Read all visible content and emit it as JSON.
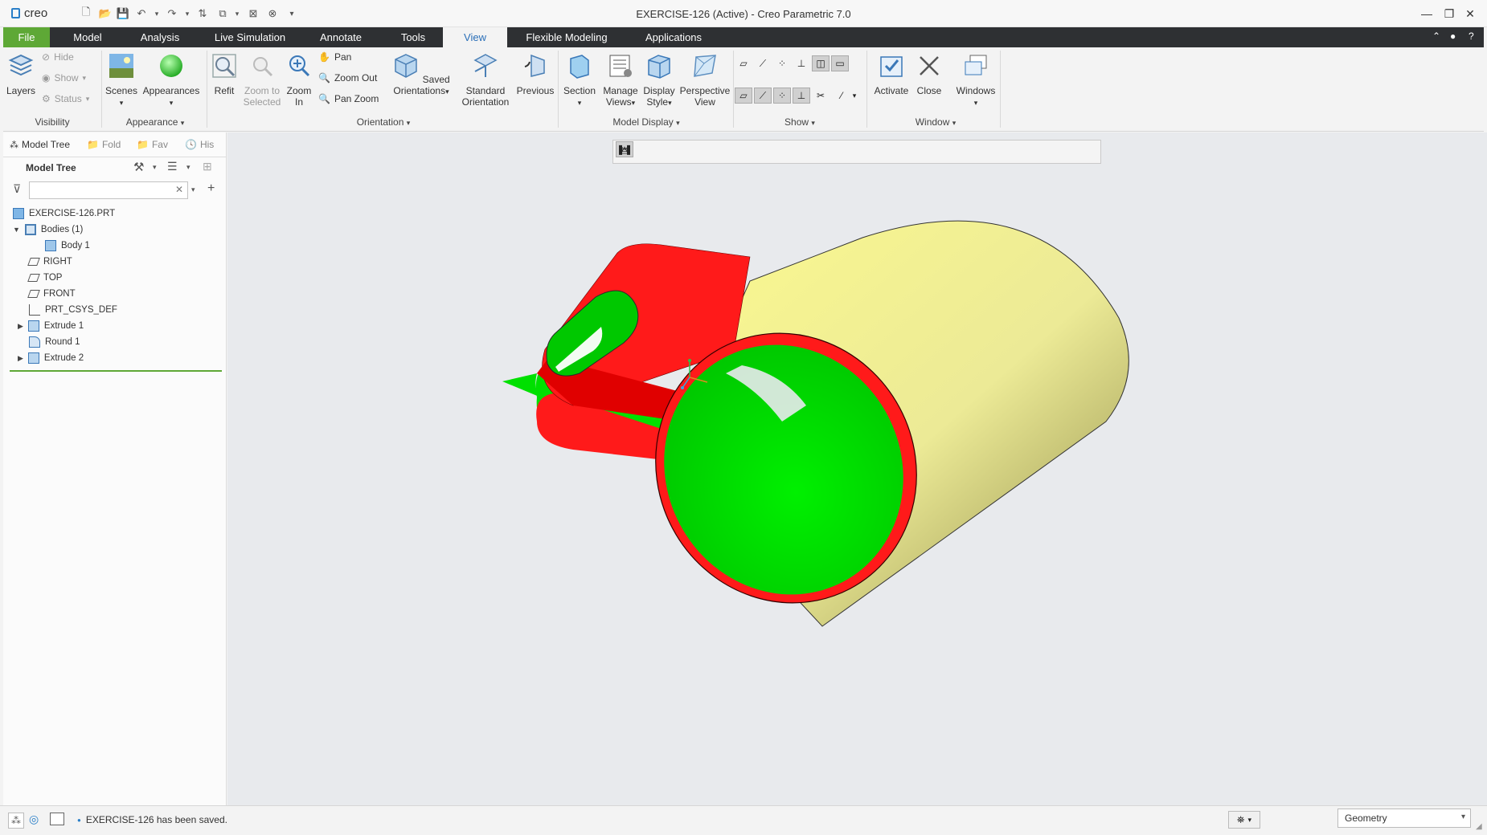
{
  "app": {
    "logo_text": "creo",
    "window_title": "EXERCISE-126 (Active) - Creo Parametric 7.0"
  },
  "ribbon_tabs": [
    {
      "label": "File"
    },
    {
      "label": "Model"
    },
    {
      "label": "Analysis"
    },
    {
      "label": "Live Simulation"
    },
    {
      "label": "Annotate"
    },
    {
      "label": "Tools"
    },
    {
      "label": "View"
    },
    {
      "label": "Flexible Modeling"
    },
    {
      "label": "Applications"
    }
  ],
  "ribbon": {
    "visibility": {
      "layers": "Layers",
      "hide": "Hide",
      "show": "Show",
      "status": "Status",
      "group": "Visibility"
    },
    "appearance": {
      "scenes": "Scenes",
      "appearances": "Appearances",
      "group": "Appearance"
    },
    "orientation": {
      "refit": "Refit",
      "zoom_to_selected_1": "Zoom to",
      "zoom_to_selected_2": "Selected",
      "zoom_in_1": "Zoom",
      "zoom_in_2": "In",
      "pan": "Pan",
      "zoom_out": "Zoom Out",
      "pan_zoom": "Pan Zoom",
      "saved_1": "Saved",
      "saved_2": "Orientations",
      "standard_1": "Standard",
      "standard_2": "Orientation",
      "previous": "Previous",
      "group": "Orientation"
    },
    "model_display": {
      "section": "Section",
      "manage_1": "Manage",
      "manage_2": "Views",
      "display_1": "Display",
      "display_2": "Style",
      "perspective_1": "Perspective",
      "perspective_2": "View",
      "group": "Model Display"
    },
    "show": {
      "group": "Show"
    },
    "window": {
      "activate": "Activate",
      "close": "Close",
      "windows": "Windows",
      "group": "Window"
    }
  },
  "left_panel": {
    "tabs": [
      "Model Tree",
      "Fold",
      "Fav",
      "His"
    ],
    "header": "Model Tree",
    "search_placeholder": "",
    "tree": [
      {
        "label": "EXERCISE-126.PRT",
        "icon": "part-icon"
      },
      {
        "label": "Bodies (1)",
        "icon": "bodies-icon"
      },
      {
        "label": "Body 1",
        "icon": "body-icon"
      },
      {
        "label": "RIGHT",
        "icon": "datum-plane-icon"
      },
      {
        "label": "TOP",
        "icon": "datum-plane-icon"
      },
      {
        "label": "FRONT",
        "icon": "datum-plane-icon"
      },
      {
        "label": "PRT_CSYS_DEF",
        "icon": "csys-icon"
      },
      {
        "label": "Extrude 1",
        "icon": "extrude-icon"
      },
      {
        "label": "Round 1",
        "icon": "round-icon"
      },
      {
        "label": "Extrude 2",
        "icon": "extrude-icon"
      }
    ]
  },
  "status": {
    "message": "EXERCISE-126 has been saved.",
    "filter": "Geometry"
  },
  "colors": {
    "file_tab": "#5ea836",
    "tab_bar": "#2e3033",
    "active_tab_text": "#2a6fb8",
    "model_red": "#ff1a1a",
    "model_green": "#00ee00",
    "model_yellow": "#f2f08c",
    "graphics_bg": "#e8eaed"
  }
}
